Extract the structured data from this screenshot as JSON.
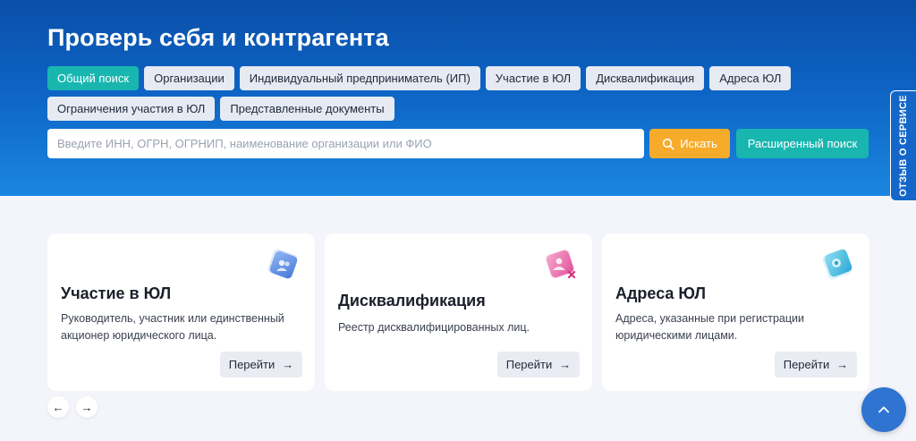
{
  "hero": {
    "title": "Проверь себя и контрагента"
  },
  "tabs": {
    "row1": [
      {
        "label": "Общий поиск",
        "active": true
      },
      {
        "label": "Организации"
      },
      {
        "label": "Индивидуальный предприниматель (ИП)"
      },
      {
        "label": "Участие в ЮЛ"
      },
      {
        "label": "Дисквалификация"
      },
      {
        "label": "Адреса ЮЛ"
      }
    ],
    "row2": [
      {
        "label": "Ограничения участия в ЮЛ"
      },
      {
        "label": "Представленные документы"
      }
    ]
  },
  "search": {
    "placeholder": "Введите ИНН, ОГРН, ОГРНИП, наименование организации или ФИО",
    "value": "",
    "submit_label": "Искать",
    "advanced_label": "Расширенный поиск"
  },
  "feedback": {
    "label": "ОТЗЫВ О СЕРВИСЕ"
  },
  "cards": [
    {
      "title": "Участие в ЮЛ",
      "desc": "Руководитель, участник или единственный акционер юридического лица.",
      "button": "Перейти",
      "icon": "participation-icon"
    },
    {
      "title": "Дисквалификация",
      "desc": "Реестр дисквалифицированных лиц.",
      "button": "Перейти",
      "icon": "disqualification-icon"
    },
    {
      "title": "Адреса ЮЛ",
      "desc": "Адреса, указанные при регистрации юридическими лицами.",
      "button": "Перейти",
      "icon": "address-icon"
    }
  ],
  "colors": {
    "accent_teal": "#19b6b0",
    "accent_orange": "#f6ac2a",
    "hero_blue": "#0d63c4"
  }
}
